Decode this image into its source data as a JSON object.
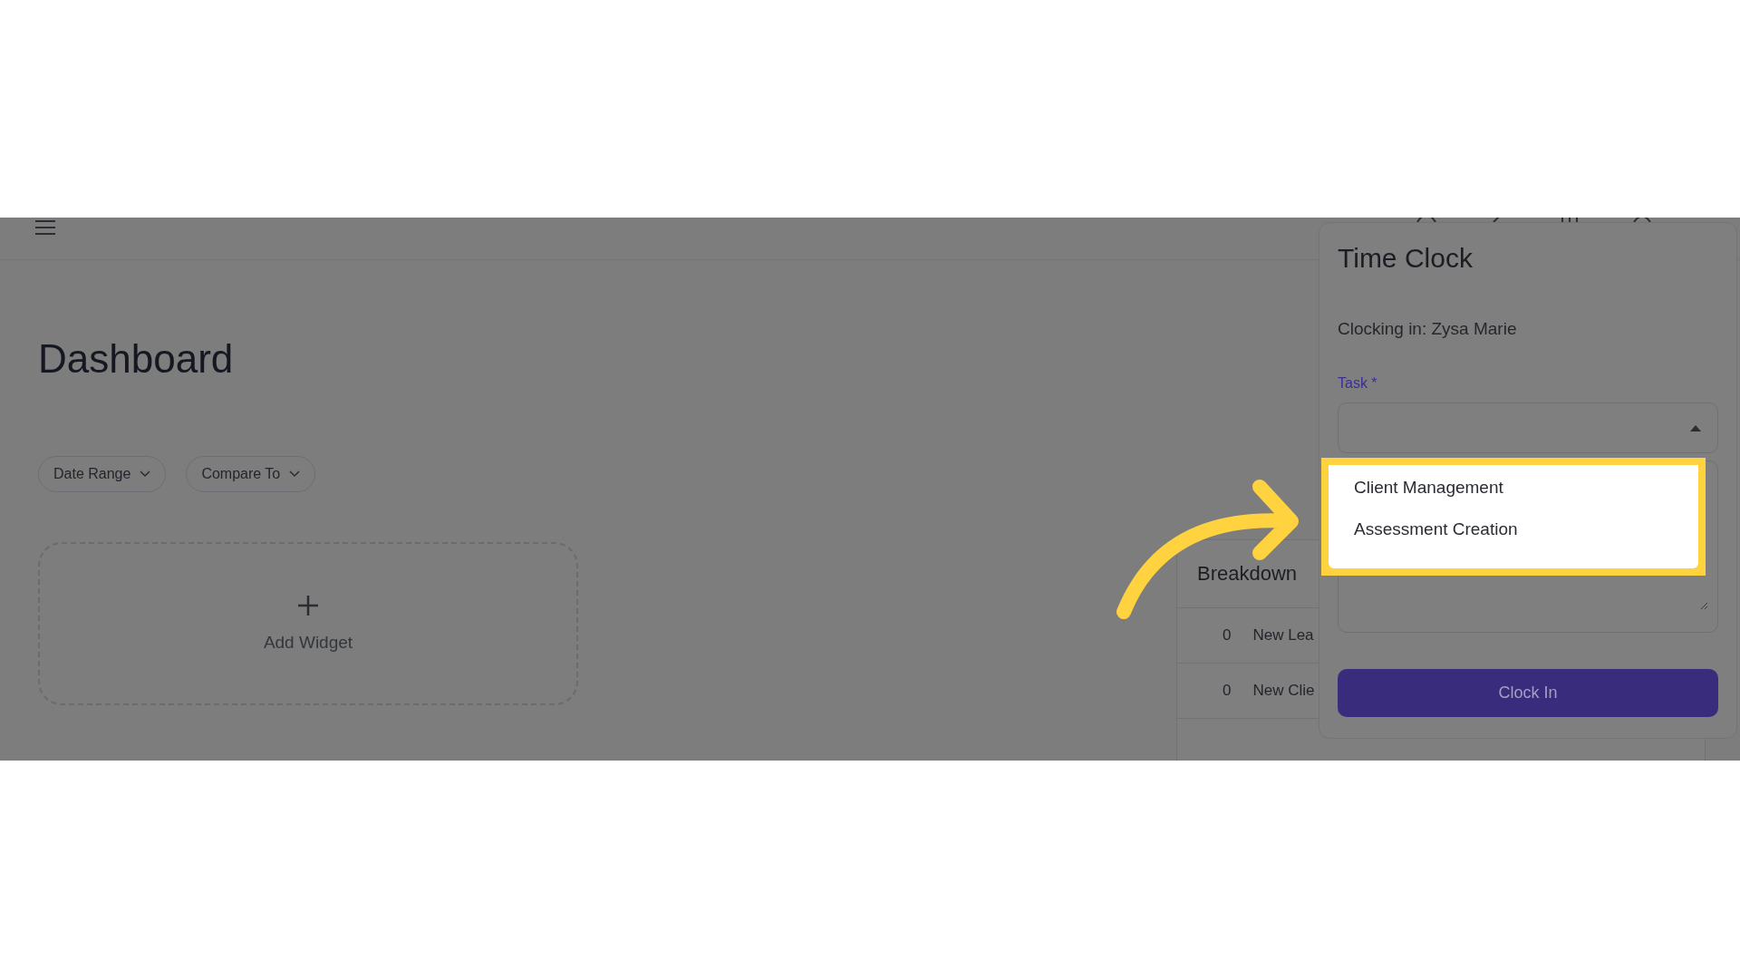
{
  "page": {
    "title": "Dashboard",
    "filters": [
      {
        "label": "Date Range"
      },
      {
        "label": "Compare To"
      }
    ],
    "add_widget": {
      "label": "Add Widget"
    }
  },
  "breakdown": {
    "title": "Breakdown",
    "rows": [
      {
        "count": "0",
        "label": "New Lea"
      },
      {
        "count": "0",
        "label": "New Clie"
      }
    ]
  },
  "time_clock": {
    "title": "Time Clock",
    "clocking_in": "Clocking in: Zysa Marie",
    "task_field": {
      "label": "Task *",
      "expanded": true,
      "options": [
        {
          "label": "Client Management"
        },
        {
          "label": "Assessment Creation"
        }
      ]
    },
    "button": "Clock In"
  }
}
